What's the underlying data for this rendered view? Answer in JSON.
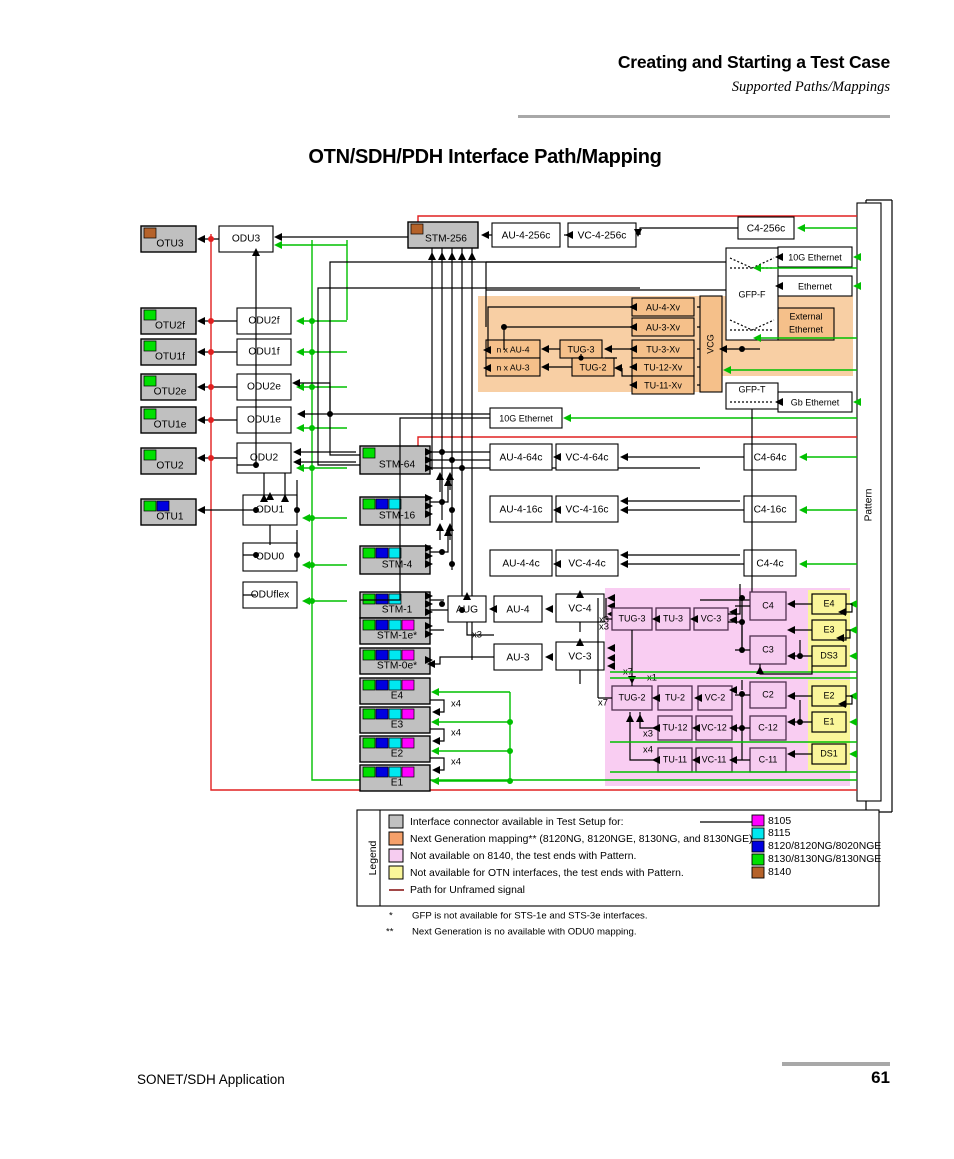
{
  "header": {
    "title": "Creating and Starting a Test Case",
    "subtitle": "Supported Paths/Mappings"
  },
  "figure_title": "OTN/SDH/PDH Interface Path/Mapping",
  "footer": {
    "left": "SONET/SDH Application",
    "page": "61"
  },
  "diagram": {
    "otn_clients": [
      {
        "label": "OTU3",
        "swatches": [
          "8140"
        ]
      },
      {
        "label": "OTU2f",
        "swatches": [
          "8130"
        ]
      },
      {
        "label": "OTU1f",
        "swatches": [
          "8130"
        ]
      },
      {
        "label": "OTU2e",
        "swatches": [
          "8130"
        ]
      },
      {
        "label": "OTU1e",
        "swatches": [
          "8130"
        ]
      },
      {
        "label": "OTU2",
        "swatches": [
          "8130"
        ]
      },
      {
        "label": "OTU1",
        "swatches": [
          "8130",
          "8120"
        ]
      }
    ],
    "odu_boxes": [
      "ODU3",
      "ODU2f",
      "ODU1f",
      "ODU2e",
      "ODU1e",
      "ODU2",
      "ODU1",
      "ODU0",
      "ODUflex"
    ],
    "stm_boxes": [
      {
        "label": "STM-256",
        "swatches": [
          "8140"
        ]
      },
      {
        "label": "STM-64",
        "swatches": [
          "8130"
        ]
      },
      {
        "label": "STM-16",
        "swatches": [
          "8130",
          "8120",
          "8115"
        ]
      },
      {
        "label": "STM-4",
        "swatches": [
          "8130",
          "8120",
          "8115"
        ]
      },
      {
        "label": "STM-1",
        "swatches": [
          "8130",
          "8120",
          "8115"
        ]
      },
      {
        "label": "STM-1e*",
        "swatches": [
          "8130",
          "8120",
          "8115",
          "8105"
        ]
      },
      {
        "label": "STM-0e*",
        "swatches": [
          "8130",
          "8120",
          "8115",
          "8105"
        ]
      },
      {
        "label": "E4",
        "swatches": [
          "8130",
          "8120",
          "8115",
          "8105"
        ]
      },
      {
        "label": "E3",
        "swatches": [
          "8130",
          "8120",
          "8115",
          "8105"
        ]
      },
      {
        "label": "E2",
        "swatches": [
          "8130",
          "8120",
          "8115",
          "8105"
        ]
      },
      {
        "label": "E1",
        "swatches": [
          "8130",
          "8120",
          "8115",
          "8105"
        ]
      }
    ],
    "au_boxes": [
      "AU-4-256c",
      "AU-4-64c",
      "AU-4-16c",
      "AU-4-4c",
      "AU-4",
      "AU-3",
      "AUG"
    ],
    "vc_boxes": [
      "VC-4-256c",
      "VC-4-64c",
      "VC-4-16c",
      "VC-4-4c",
      "VC-4",
      "VC-3"
    ],
    "c_boxes": [
      "C4-256c",
      "C4-64c",
      "C4-16c",
      "C4-4c"
    ],
    "vcg_region": {
      "label": "VCG",
      "xv_boxes": [
        "AU-4-Xv",
        "AU-3-Xv",
        "TU-3-Xv",
        "TU-12-Xv",
        "TU-11-Xv"
      ],
      "tug_boxes": [
        "TUG-3",
        "TUG-2"
      ],
      "n_boxes": [
        "n x AU-4",
        "n x AU-3"
      ],
      "external": "External\nEthernet"
    },
    "gfp": {
      "f": "GFP-F",
      "t": "GFP-T"
    },
    "ethernet_boxes": [
      "10G Ethernet",
      "Ethernet",
      "Gb Ethernet",
      "10G Ethernet"
    ],
    "pattern_label": "Pattern",
    "pink_region": {
      "row1": [
        "TUG-3",
        "TU-3",
        "VC-3",
        "C4"
      ],
      "row2": [
        "C3"
      ],
      "row3": [
        "TUG-2",
        "TU-2",
        "VC-2",
        "C2"
      ],
      "row4": [
        "TU-12",
        "VC-12",
        "C-12"
      ],
      "row5": [
        "TU-11",
        "VC-11",
        "C-11"
      ],
      "pdh": [
        "E4",
        "E3",
        "DS3",
        "E2",
        "E1",
        "DS1"
      ],
      "multipliers": [
        "x3",
        "x7",
        "x1",
        "x3",
        "x4",
        "x7",
        "x3"
      ]
    },
    "multipliers_left": [
      "x3",
      "x3",
      "x4",
      "x4",
      "x4"
    ]
  },
  "legend": {
    "title": "Legend",
    "rows": [
      {
        "swatch": "#c0c0c0",
        "text": "Interface connector available in Test Setup for:"
      },
      {
        "swatch": "#f5a06a",
        "text": "Next Generation mapping** (8120NG, 8120NGE, 8130NG, and 8130NGE)."
      },
      {
        "swatch": "#f6ccf0",
        "text": "Not available on 8140, the test ends with Pattern."
      },
      {
        "swatch": "#faf69a",
        "text": "Not available for OTN interfaces, the test ends with Pattern."
      },
      {
        "swatch": "line",
        "text": "Path for Unframed signal"
      }
    ],
    "models": [
      {
        "color": "#ff00ff",
        "name": "8105"
      },
      {
        "color": "#00e8f0",
        "name": "8115"
      },
      {
        "color": "#0000e0",
        "name": "8120/8120NG/8020NGE"
      },
      {
        "color": "#00e000",
        "name": "8130/8130NG/8130NGE"
      },
      {
        "color": "#b5622a",
        "name": "8140"
      }
    ]
  },
  "notes": [
    {
      "marker": "*",
      "text": "GFP is not available for STS-1e and STS-3e interfaces."
    },
    {
      "marker": "**",
      "text": "Next Generation is no available with ODU0 mapping."
    }
  ],
  "colors": {
    "8105": "#ff00ff",
    "8115": "#00e8f0",
    "8120": "#0000e0",
    "8130": "#00e000",
    "8140": "#b5622a",
    "gray_box": "#c0c0c0",
    "orange_region": "#f8cfa4",
    "pink_region": "#f9cdf2",
    "yellow_box": "#faf69a",
    "green_wire": "#00c000",
    "red_wire": "#e02020"
  }
}
